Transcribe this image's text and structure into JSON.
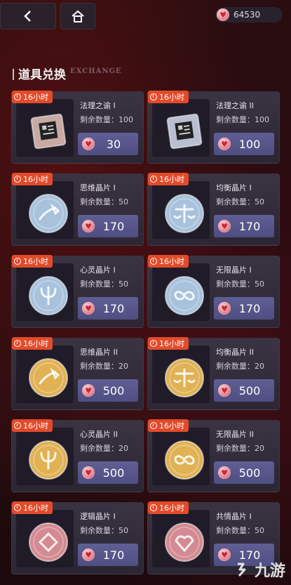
{
  "currency": {
    "amount": "64530"
  },
  "section": {
    "title": "道具兑换",
    "subtitle": "EXCHANGE"
  },
  "items": [
    {
      "timer": "16小时",
      "name": "法理之谕 I",
      "remain": "剩余数量：100",
      "price": "30",
      "icon": "rule-tablet-icon",
      "tint": "#c9a9a4"
    },
    {
      "timer": "16小时",
      "name": "法理之谕 II",
      "remain": "剩余数量：100",
      "price": "100",
      "icon": "rule-tablet-icon",
      "tint": "#b9bfd0"
    },
    {
      "timer": "16小时",
      "name": "思维晶片 I",
      "remain": "剩余数量：50",
      "price": "170",
      "icon": "pipe-coin-icon",
      "tint": "#a8c2dc"
    },
    {
      "timer": "16小时",
      "name": "均衡晶片 I",
      "remain": "剩余数量：50",
      "price": "170",
      "icon": "scales-coin-icon",
      "tint": "#a8c2dc"
    },
    {
      "timer": "16小时",
      "name": "心灵晶片 I",
      "remain": "剩余数量：50",
      "price": "170",
      "icon": "psi-coin-icon",
      "tint": "#a8c2dc"
    },
    {
      "timer": "16小时",
      "name": "无限晶片 I",
      "remain": "剩余数量：50",
      "price": "170",
      "icon": "infinity-coin-icon",
      "tint": "#a8c2dc"
    },
    {
      "timer": "16小时",
      "name": "思维晶片 II",
      "remain": "剩余数量：20",
      "price": "500",
      "icon": "pipe-coin-icon",
      "tint": "#e0b255"
    },
    {
      "timer": "16小时",
      "name": "均衡晶片 II",
      "remain": "剩余数量：20",
      "price": "500",
      "icon": "scales-coin-icon",
      "tint": "#e0b255"
    },
    {
      "timer": "16小时",
      "name": "心灵晶片 II",
      "remain": "剩余数量：20",
      "price": "500",
      "icon": "psi-coin-icon",
      "tint": "#e0b255"
    },
    {
      "timer": "16小时",
      "name": "无限晶片 II",
      "remain": "剩余数量：20",
      "price": "500",
      "icon": "infinity-coin-icon",
      "tint": "#e0b255"
    },
    {
      "timer": "16小时",
      "name": "逻辑晶片 I",
      "remain": "剩余数量：50",
      "price": "170",
      "icon": "diamond-coin-icon",
      "tint": "#d48a92"
    },
    {
      "timer": "16小时",
      "name": "共情晶片 I",
      "remain": "剩余数量：50",
      "price": "170",
      "icon": "heart-shard-coin-icon",
      "tint": "#d48a92"
    }
  ],
  "watermark": {
    "text": "九游"
  }
}
